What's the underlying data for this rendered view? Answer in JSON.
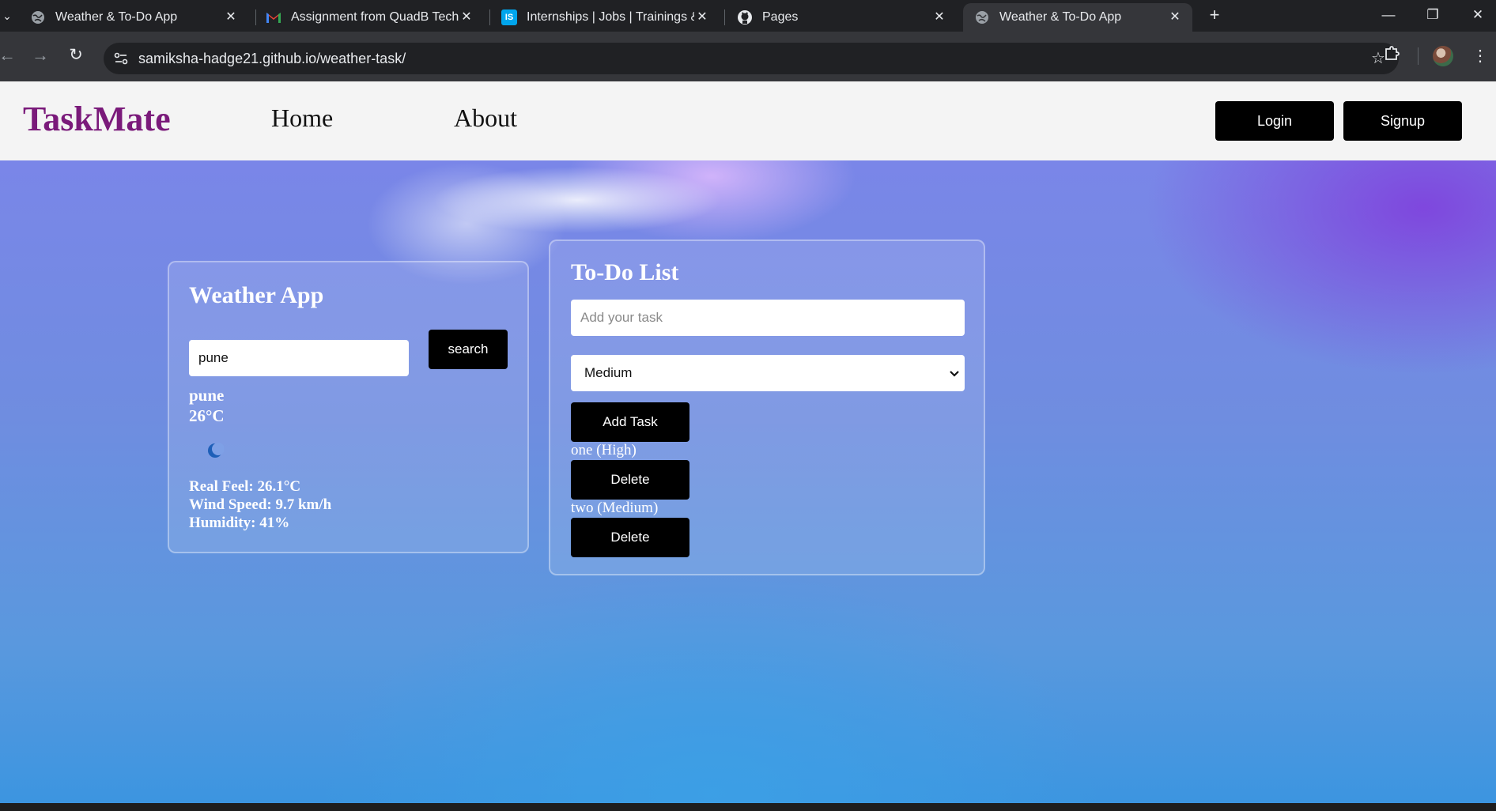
{
  "browser": {
    "tabs": [
      {
        "title": "Weather & To-Do App",
        "icon": "globe-icon"
      },
      {
        "title": "Assignment from QuadB Tech -",
        "icon": "gmail-icon"
      },
      {
        "title": "Internships | Jobs | Trainings &",
        "icon": "internshala-icon",
        "icon_text": "IS"
      },
      {
        "title": "Pages",
        "icon": "github-icon"
      },
      {
        "title": "Weather & To-Do App",
        "icon": "globe-icon"
      }
    ],
    "active_tab": 4,
    "url": "samiksha-hadge21.github.io/weather-task/",
    "close_glyph": "✕",
    "new_tab_glyph": "+"
  },
  "page": {
    "brand": "TaskMate",
    "nav": {
      "home": "Home",
      "about": "About"
    },
    "auth": {
      "login": "Login",
      "signup": "Signup"
    },
    "colors": {
      "brand": "#7a1a7a",
      "button": "#000000"
    }
  },
  "weather": {
    "title": "Weather App",
    "search_value": "pune",
    "search_button": "search",
    "city": "pune",
    "temperature": "26°C",
    "icon": "crescent-moon-icon",
    "real_feel": "Real Feel: 26.1°C",
    "wind_speed": "Wind Speed: 9.7 km/h",
    "humidity": "Humidity: 41%"
  },
  "todo": {
    "title": "To-Do List",
    "input_placeholder": "Add your task",
    "priority_selected": "Medium",
    "add_button": "Add Task",
    "tasks": [
      {
        "text": "one (High)",
        "delete": "Delete"
      },
      {
        "text": "two (Medium)",
        "delete": "Delete"
      }
    ]
  }
}
